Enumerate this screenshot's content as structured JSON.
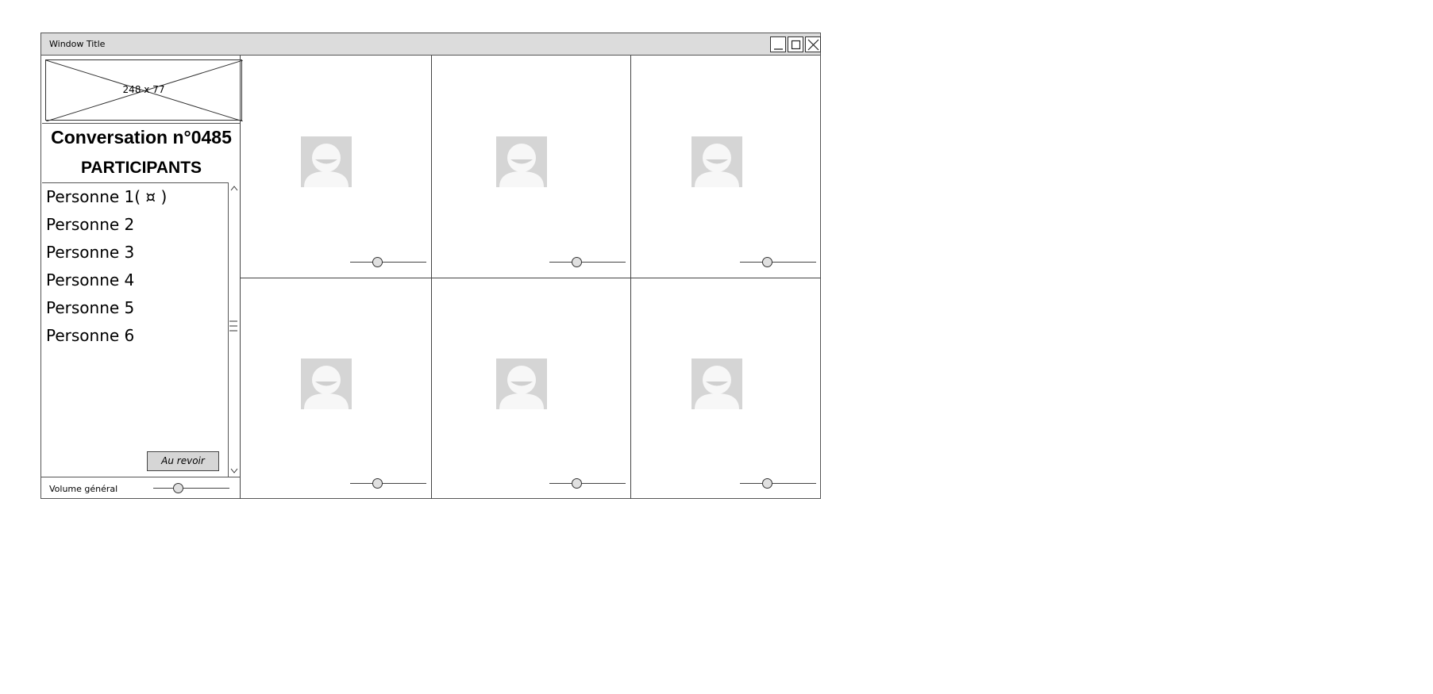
{
  "window": {
    "title": "Window Title",
    "controls": [
      "minimize-icon",
      "maximize-icon",
      "close-icon"
    ]
  },
  "sidebar": {
    "logo_placeholder": "248 x 77",
    "conversation_title": "Conversation n°0485",
    "participants_heading": "PARTICIPANTS",
    "participants": [
      "Personne 1( ¤ )",
      "Personne 2",
      "Personne 3",
      "Personne 4",
      "Personne 5",
      "Personne 6"
    ],
    "goodbye_button": "Au revoir",
    "volume_label": "Volume général",
    "volume_level": 0.3
  },
  "video_grid": {
    "tiles": [
      {
        "avatar": "user-avatar-icon",
        "volume_level": 0.34
      },
      {
        "avatar": "user-avatar-icon",
        "volume_level": 0.34
      },
      {
        "avatar": "user-avatar-icon",
        "volume_level": 0.34
      },
      {
        "avatar": "user-avatar-icon",
        "volume_level": 0.34
      },
      {
        "avatar": "user-avatar-icon",
        "volume_level": 0.34
      },
      {
        "avatar": "user-avatar-icon",
        "volume_level": 0.34
      }
    ]
  }
}
